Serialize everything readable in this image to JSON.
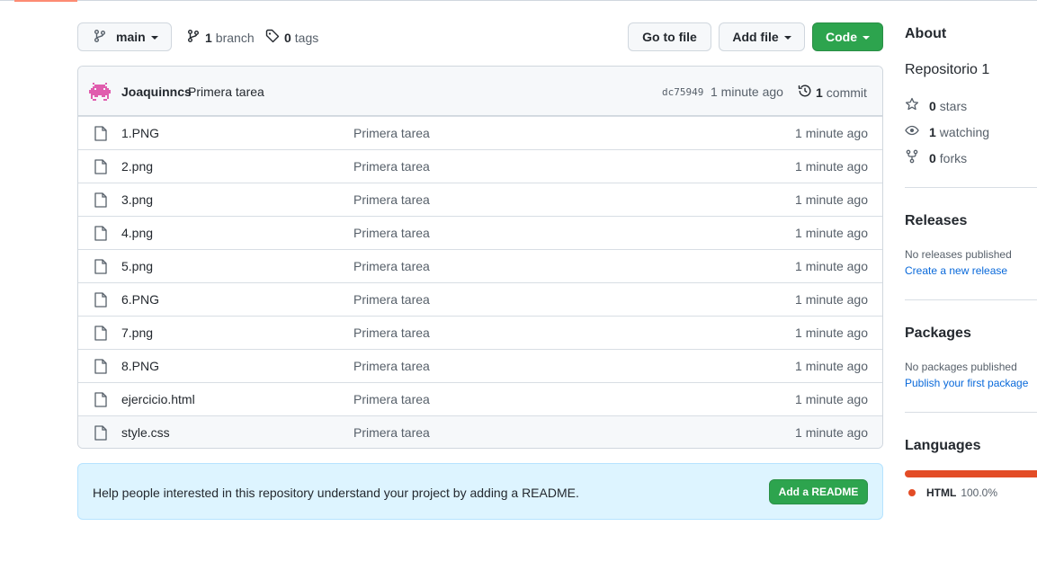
{
  "toolbar": {
    "branch_label": "main",
    "branches_count": "1",
    "branches_label": "branch",
    "tags_count": "0",
    "tags_label": "tags",
    "go_to_file_label": "Go to file",
    "add_file_label": "Add file",
    "code_label": "Code"
  },
  "commit": {
    "author": "Joaquinncs",
    "message": "Primera tarea",
    "sha": "dc75949",
    "time": "1 minute ago",
    "count": "1",
    "count_label": "commit"
  },
  "files": [
    {
      "name": "1.PNG",
      "message": "Primera tarea",
      "time": "1 minute ago"
    },
    {
      "name": "2.png",
      "message": "Primera tarea",
      "time": "1 minute ago"
    },
    {
      "name": "3.png",
      "message": "Primera tarea",
      "time": "1 minute ago"
    },
    {
      "name": "4.png",
      "message": "Primera tarea",
      "time": "1 minute ago"
    },
    {
      "name": "5.png",
      "message": "Primera tarea",
      "time": "1 minute ago"
    },
    {
      "name": "6.PNG",
      "message": "Primera tarea",
      "time": "1 minute ago"
    },
    {
      "name": "7.png",
      "message": "Primera tarea",
      "time": "1 minute ago"
    },
    {
      "name": "8.PNG",
      "message": "Primera tarea",
      "time": "1 minute ago"
    },
    {
      "name": "ejercicio.html",
      "message": "Primera tarea",
      "time": "1 minute ago"
    },
    {
      "name": "style.css",
      "message": "Primera tarea",
      "time": "1 minute ago"
    }
  ],
  "readme": {
    "text": "Help people interested in this repository understand your project by adding a README.",
    "button_label": "Add a README"
  },
  "sidebar": {
    "about_heading": "About",
    "description": "Repositorio 1",
    "stars_count": "0",
    "stars_label": "stars",
    "watching_count": "1",
    "watching_label": "watching",
    "forks_count": "0",
    "forks_label": "forks",
    "releases_heading": "Releases",
    "releases_empty": "No releases published",
    "releases_link": "Create a new release",
    "packages_heading": "Packages",
    "packages_empty": "No packages published",
    "packages_link": "Publish your first package",
    "languages_heading": "Languages",
    "language_name": "HTML",
    "language_percent": "100.0%",
    "language_color": "#e34c26"
  },
  "colors": {
    "primary_button": "#2da44e",
    "link": "#0969da",
    "readme_banner": "#ddf4ff"
  }
}
